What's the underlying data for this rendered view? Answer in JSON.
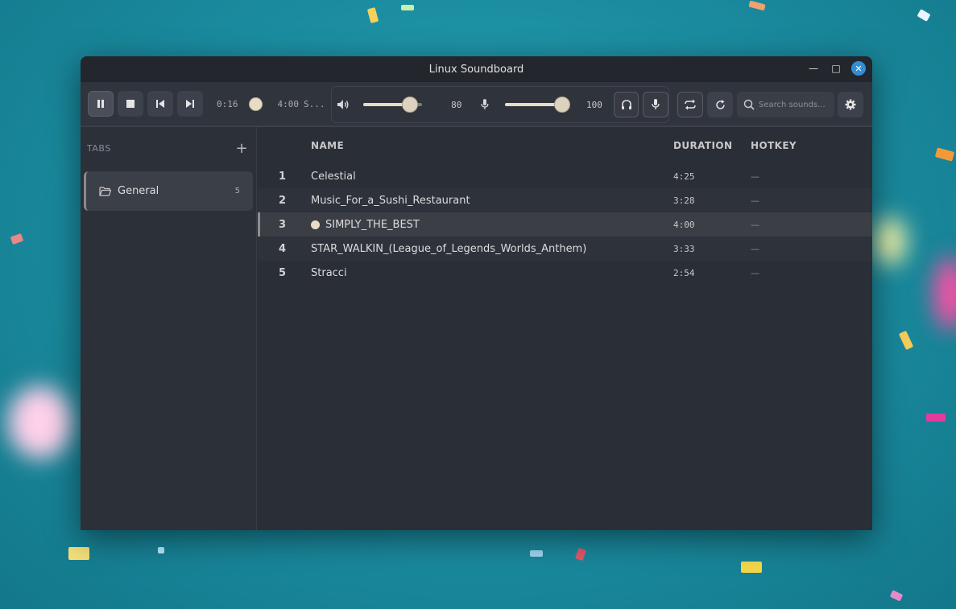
{
  "window": {
    "title": "Linux Soundboard"
  },
  "window_controls": {
    "minimize": "—",
    "maximize": "□",
    "close": "✕"
  },
  "player": {
    "elapsed": "0:16",
    "total": "4:00",
    "now_playing_short": "S...",
    "progress_fraction": 0.0667
  },
  "volume": {
    "speaker_value": "80",
    "speaker_fraction": 0.8,
    "mic_value": "100",
    "mic_fraction": 1.0
  },
  "search": {
    "placeholder": "Search sounds..."
  },
  "sidebar": {
    "header": "TABS",
    "add_label": "+",
    "tabs": [
      {
        "label": "General",
        "count": "5"
      }
    ]
  },
  "table": {
    "headers": {
      "name": "NAME",
      "duration": "DURATION",
      "hotkey": "HOTKEY"
    },
    "rows": [
      {
        "index": "1",
        "name": "Celestial",
        "duration": "4:25",
        "hotkey": "—"
      },
      {
        "index": "2",
        "name": "Music_For_a_Sushi_Restaurant",
        "duration": "3:28",
        "hotkey": "—"
      },
      {
        "index": "3",
        "name": "SIMPLY_THE_BEST",
        "duration": "4:00",
        "hotkey": "—"
      },
      {
        "index": "4",
        "name": "STAR_WALKIN_(League_of_Legends_Worlds_Anthem)",
        "duration": "3:33",
        "hotkey": "—"
      },
      {
        "index": "5",
        "name": "Stracci",
        "duration": "2:54",
        "hotkey": "—"
      }
    ],
    "playing_index": 3
  },
  "colors": {
    "accent": "#e8dcc5",
    "window_bg": "#2b2f38",
    "close_button": "#2f8ed8"
  }
}
